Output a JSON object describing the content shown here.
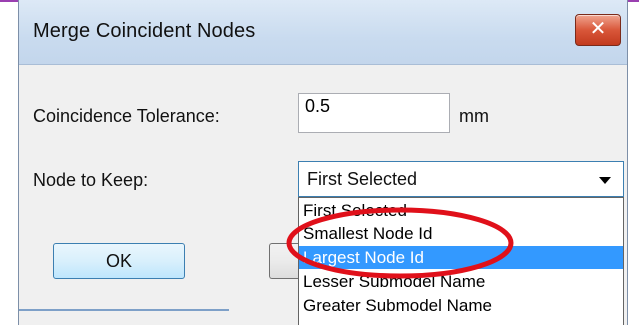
{
  "dialog": {
    "title": "Merge Coincident Nodes",
    "close_symbol": "✕"
  },
  "form": {
    "tolerance_label": "Coincidence Tolerance:",
    "tolerance_value": "0.5",
    "tolerance_unit": "mm",
    "node_label": "Node to Keep:",
    "node_selected": "First Selected",
    "options": [
      "First Selected",
      "Smallest Node Id",
      "Largest Node Id",
      "Lesser Submodel Name",
      "Greater Submodel Name"
    ],
    "highlighted_option": "Largest Node Id"
  },
  "buttons": {
    "ok_label": "OK"
  },
  "annotation": {
    "color": "#e0101a"
  },
  "colors": {
    "selection": "#3399ff",
    "close_button": "#d9573a"
  }
}
